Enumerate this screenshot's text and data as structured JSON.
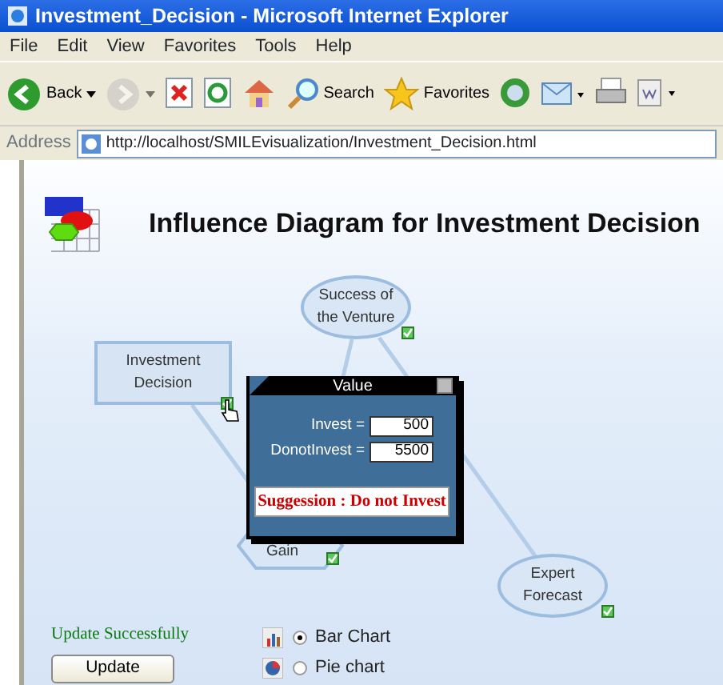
{
  "window": {
    "title": "Investment_Decision - Microsoft Internet Explorer"
  },
  "menu": [
    "File",
    "Edit",
    "View",
    "Favorites",
    "Tools",
    "Help"
  ],
  "toolbar": [
    {
      "kind": "back",
      "label": "Back",
      "disabled": false
    },
    {
      "kind": "forward",
      "disabled": true
    },
    {
      "kind": "stop"
    },
    {
      "kind": "refresh"
    },
    {
      "kind": "home"
    },
    {
      "kind": "search",
      "label": "Search"
    },
    {
      "kind": "favorites",
      "label": "Favorites"
    },
    {
      "kind": "media"
    },
    {
      "kind": "mail"
    },
    {
      "kind": "print"
    },
    {
      "kind": "word"
    }
  ],
  "address": {
    "label": "Address",
    "url": "http://localhost/SMILEvisualization/Investment_Decision.html"
  },
  "page": {
    "title": "Influence Diagram for Investment Decision"
  },
  "nodes": [
    {
      "kind": "ellipse",
      "lines": [
        "Success of",
        "the Venture"
      ],
      "checked": true
    },
    {
      "kind": "rect",
      "lines": [
        "Investment",
        "Decision"
      ],
      "checked": true
    },
    {
      "kind": "hexagon",
      "lines": [
        "Gain"
      ],
      "checked": true
    },
    {
      "kind": "ellipse",
      "lines": [
        "Expert",
        "Forecast"
      ],
      "checked": true
    }
  ],
  "popup": {
    "title": "Value",
    "fields": [
      {
        "label": "Invest =",
        "value": "500"
      },
      {
        "label": "DonotInvest =",
        "value": "5500"
      }
    ],
    "suggestion": "Suggession : Do not Invest"
  },
  "status": "Update Successfully",
  "update_button": "Update",
  "chart_options": [
    {
      "kind": "bar",
      "label": "Bar Chart",
      "selected": true
    },
    {
      "kind": "pie",
      "label": "Pie chart",
      "selected": false
    }
  ]
}
